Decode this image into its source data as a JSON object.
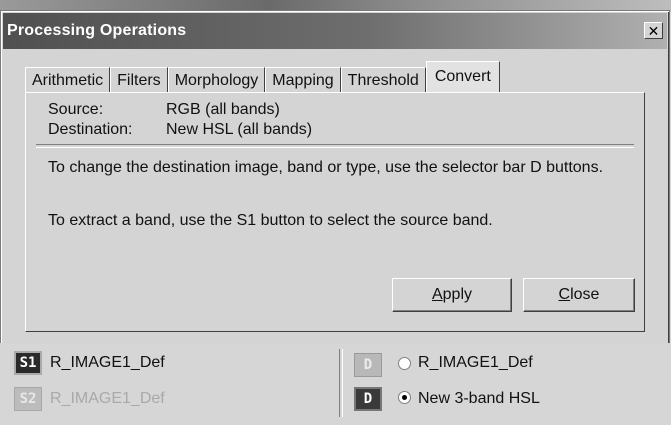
{
  "window": {
    "title": "Processing Operations",
    "close_glyph": "✕"
  },
  "tabs": [
    {
      "label": "Arithmetic"
    },
    {
      "label": "Filters"
    },
    {
      "label": "Morphology"
    },
    {
      "label": "Mapping"
    },
    {
      "label": "Threshold"
    },
    {
      "label": "Convert",
      "active": true
    }
  ],
  "panel": {
    "source_label": "Source:",
    "source_value": "RGB (all bands)",
    "destination_label": "Destination:",
    "destination_value": "New HSL (all bands)",
    "message1": "To change the destination image, band or type, use the selector bar D buttons.",
    "message2": "To extract a band, use the S1 button to select the source band.",
    "apply_label": "Apply",
    "apply_accel": "A",
    "apply_rest": "pply",
    "close_label": "Close",
    "close_accel": "C",
    "close_rest": "lose"
  },
  "selector_bar": {
    "s1": {
      "badge": "S1",
      "label": "R_IMAGE1_Def"
    },
    "s2": {
      "badge": "S2",
      "label": "R_IMAGE1_Def"
    },
    "d_top": {
      "badge": "D",
      "label": "R_IMAGE1_Def",
      "selected": false
    },
    "d_bottom": {
      "badge": "D",
      "label": "New 3-band HSL",
      "selected": true
    }
  }
}
